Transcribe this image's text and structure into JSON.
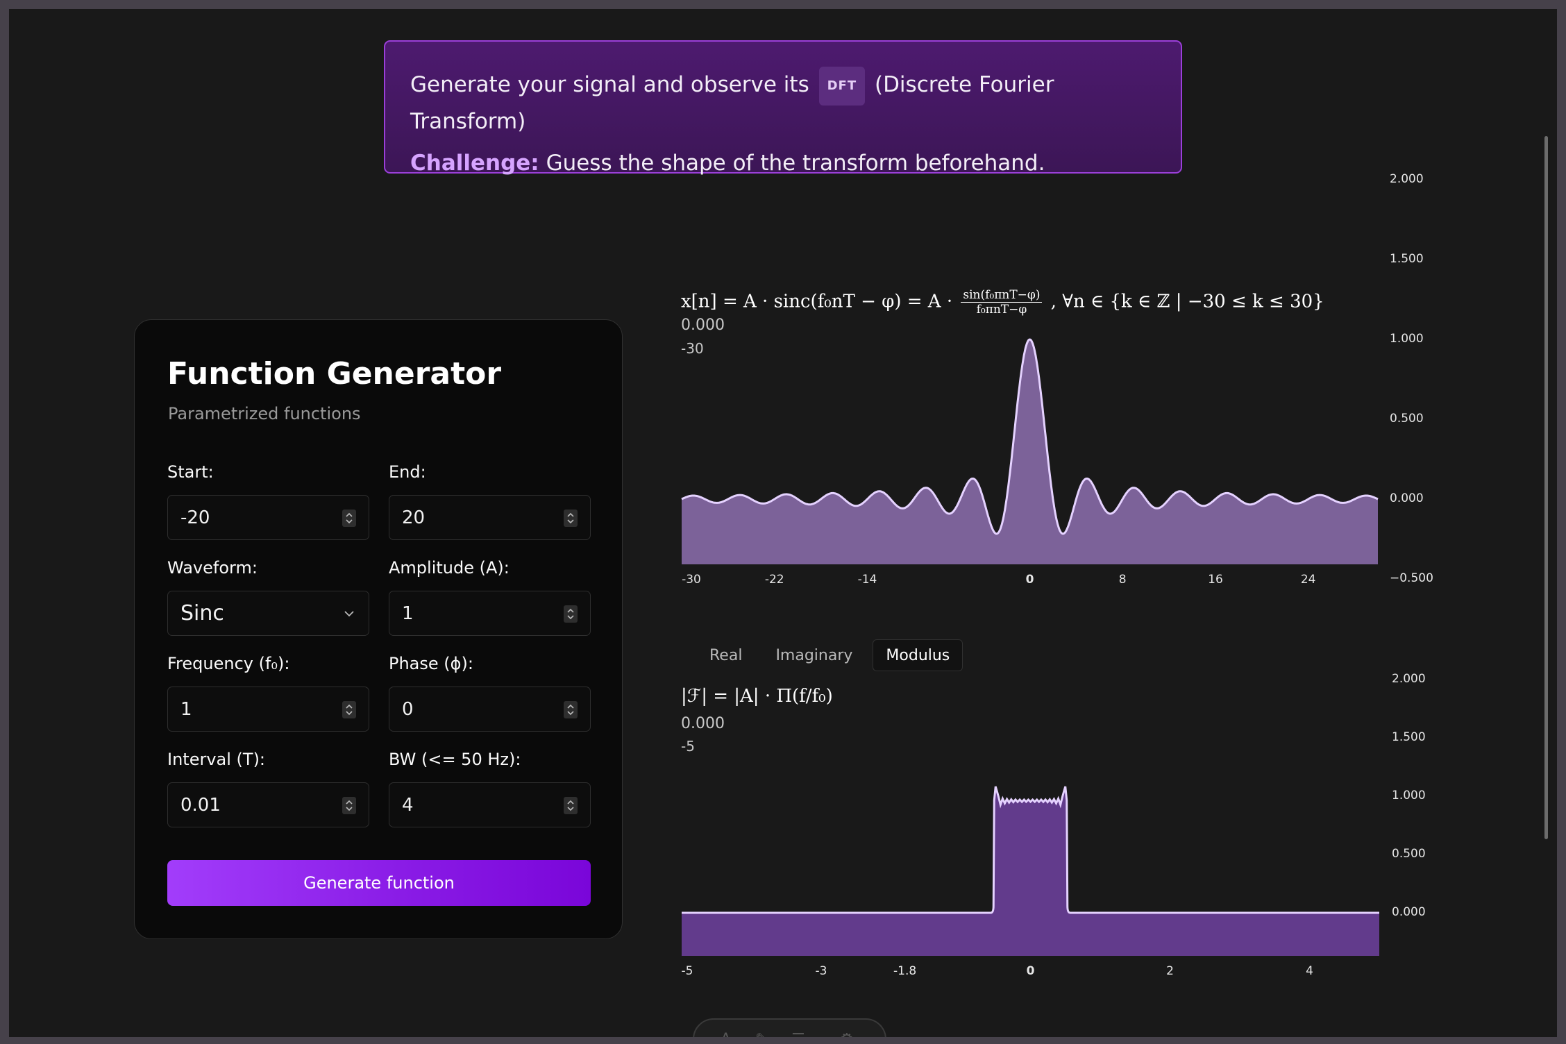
{
  "banner": {
    "line1_text": "Generate your signal and observe its",
    "badge": "DFT",
    "line1_suffix": "(Discrete Fourier Transform)",
    "challenge_label": "Challenge:",
    "challenge_text": "Guess the shape of the transform beforehand."
  },
  "generator": {
    "title": "Function Generator",
    "subtitle": "Parametrized functions",
    "start_label": "Start:",
    "start_value": "-20",
    "end_label": "End:",
    "end_value": "20",
    "waveform_label": "Waveform:",
    "waveform_value": "Sinc",
    "amplitude_label": "Amplitude (A):",
    "amplitude_value": "1",
    "frequency_label": "Frequency (f₀):",
    "frequency_value": "1",
    "phase_label": "Phase (ϕ):",
    "phase_value": "0",
    "interval_label": "Interval (T):",
    "interval_value": "0.01",
    "bw_label": "BW (<= 50 Hz):",
    "bw_value": "4",
    "generate_button": "Generate function"
  },
  "signal_chart": {
    "readout_value": "0.000",
    "readout_x": "-30",
    "formula_parts": {
      "lhs": "x[n] = A · sinc(f₀nT − φ) = A ·",
      "frac_num": "sin(f₀πnT−φ)",
      "frac_den": "f₀πnT−φ",
      "rhs": ", ∀n ∈ {k ∈ ℤ | −30 ≤ k ≤ 30}"
    }
  },
  "transform_chart": {
    "tabs": [
      "Real",
      "Imaginary",
      "Modulus"
    ],
    "active_tab": "Modulus",
    "formula": "|ℱ| = |A| · Π(f/f₀)",
    "readout_value": "0.000",
    "readout_x": "-5"
  },
  "chart_data": [
    {
      "type": "area",
      "series": [
        {
          "name": "x[n]",
          "function": "sinc",
          "amplitude": 1,
          "frequency": 1,
          "phase": 0
        }
      ],
      "x_range": [
        -30,
        30
      ],
      "ylim": [
        -0.5,
        2
      ],
      "x_ticks": [
        "-30",
        "-22",
        "-14",
        "0",
        "8",
        "16",
        "24"
      ],
      "y_ticks": [
        "2.000",
        "1.500",
        "1.000",
        "0.500",
        "0.000",
        "−0.500"
      ],
      "colors": {
        "fill": "#8e70b0",
        "line": "#e5d2ff"
      }
    },
    {
      "type": "area",
      "series": [
        {
          "name": "|F|",
          "shape": "rect",
          "height": 1.0,
          "width": 1.0,
          "center": 0
        }
      ],
      "x_range": [
        -5,
        5
      ],
      "ylim": [
        -0.7,
        2
      ],
      "x_ticks": [
        "-5",
        "-3",
        "-1.8",
        "0",
        "2",
        "4"
      ],
      "y_ticks": [
        "2.000",
        "1.500",
        "1.000",
        "0.500",
        "0.000"
      ],
      "colors": {
        "fill": "#6a3f99",
        "line": "#e5d2ff"
      }
    }
  ]
}
